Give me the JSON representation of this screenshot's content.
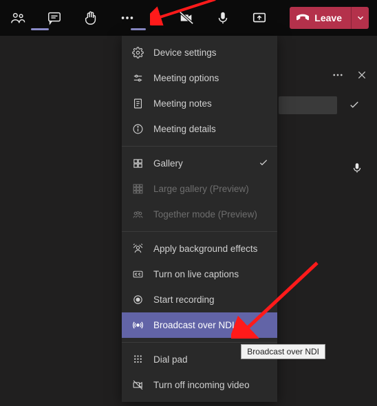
{
  "toolbar": {
    "leave_label": "Leave"
  },
  "menu": {
    "device_settings": "Device settings",
    "meeting_options": "Meeting options",
    "meeting_notes": "Meeting notes",
    "meeting_details": "Meeting details",
    "gallery": "Gallery",
    "large_gallery": "Large gallery (Preview)",
    "together_mode": "Together mode (Preview)",
    "apply_bg": "Apply background effects",
    "live_captions": "Turn on live captions",
    "start_recording": "Start recording",
    "broadcast_ndi": "Broadcast over NDI",
    "dial_pad": "Dial pad",
    "turn_off_video": "Turn off incoming video"
  },
  "tooltip": {
    "broadcast_ndi": "Broadcast over NDI"
  }
}
